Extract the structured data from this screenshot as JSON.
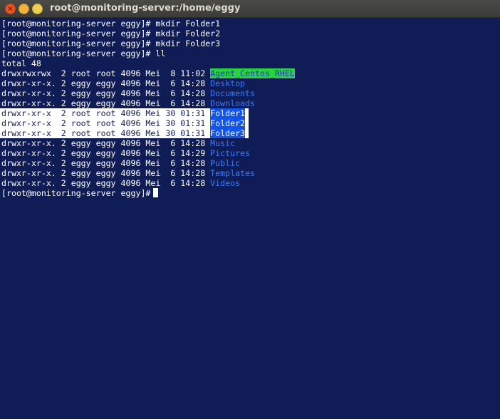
{
  "window": {
    "title": "root@monitoring-server:/home/eggy",
    "close_glyph": "×"
  },
  "terminal": {
    "lines": [
      {
        "text": "[root@monitoring-server eggy]# mkdir Folder1"
      },
      {
        "text": "[root@monitoring-server eggy]# mkdir Folder2"
      },
      {
        "text": "[root@monitoring-server eggy]# mkdir Folder3"
      },
      {
        "text": "[root@monitoring-server eggy]# ll"
      },
      {
        "text": "total 48"
      }
    ],
    "listing": [
      {
        "meta": "drwxrwxrwx  2 root root 4096 Mei  8 11:02 ",
        "name": "Agent_Centos_RHEL",
        "style": "other-w"
      },
      {
        "meta": "drwxr-xr-x. 2 eggy eggy 4096 Mei  6 14:28 ",
        "name": "Desktop",
        "style": "dir"
      },
      {
        "meta": "drwxr-xr-x. 2 eggy eggy 4096 Mei  6 14:28 ",
        "name": "Documents",
        "style": "dir"
      },
      {
        "meta": "drwxr-xr-x. 2 eggy eggy 4096 Mei  6 14:28 ",
        "name": "Downloads",
        "style": "dir"
      },
      {
        "meta": "drwxr-xr-x  2 root root 4096 Mei 30 01:31 ",
        "name": "Folder1",
        "style": "selected"
      },
      {
        "meta": "drwxr-xr-x  2 root root 4096 Mei 30 01:31 ",
        "name": "Folder2",
        "style": "selected"
      },
      {
        "meta": "drwxr-xr-x  2 root root 4096 Mei 30 01:31 ",
        "name": "Folder3",
        "style": "selected"
      },
      {
        "meta": "drwxr-xr-x. 2 eggy eggy 4096 Mei  6 14:28 ",
        "name": "Music",
        "style": "dir"
      },
      {
        "meta": "drwxr-xr-x. 2 eggy eggy 4096 Mei  6 14:29 ",
        "name": "Pictures",
        "style": "dir"
      },
      {
        "meta": "drwxr-xr-x. 2 eggy eggy 4096 Mei  6 14:28 ",
        "name": "Public",
        "style": "dir"
      },
      {
        "meta": "drwxr-xr-x. 2 eggy eggy 4096 Mei  6 14:28 ",
        "name": "Templates",
        "style": "dir"
      },
      {
        "meta": "drwxr-xr-x. 2 eggy eggy 4096 Mei  6 14:28 ",
        "name": "Videos",
        "style": "dir"
      }
    ],
    "prompt": "[root@monitoring-server eggy]#"
  },
  "colors": {
    "background": "#101c55",
    "directory": "#3a7cff",
    "selection": "#ffffff",
    "selected_name_bg": "#1155ee",
    "other_writable_bg": "#29d33d",
    "close_button": "#e95420"
  }
}
